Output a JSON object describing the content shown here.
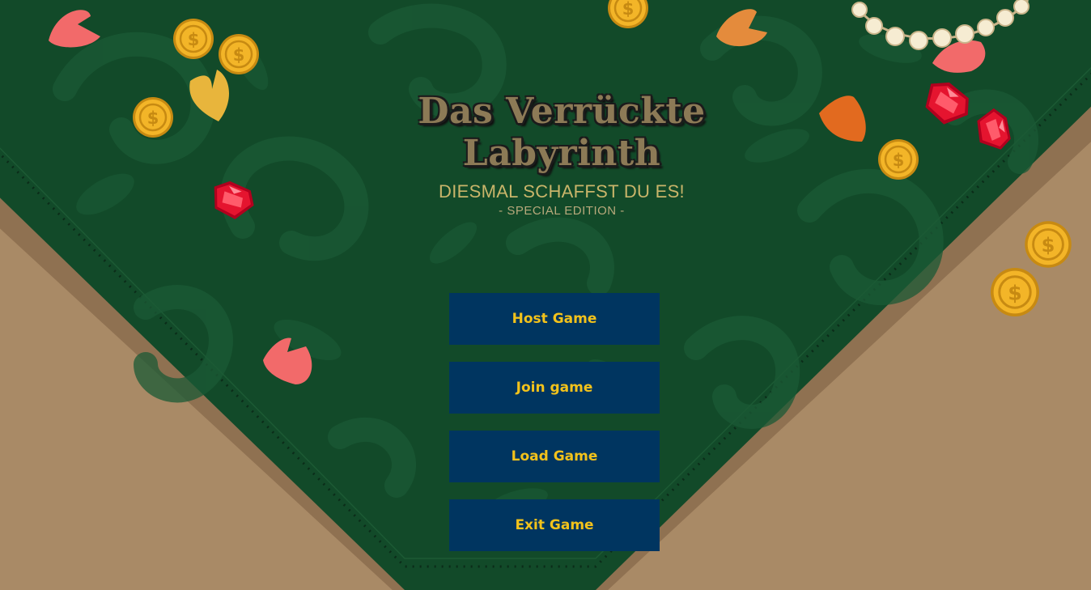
{
  "title": {
    "line1": "Das Verrückte",
    "line2": "Labyrinth"
  },
  "subtitle": "DIESMAL SCHAFFST DU ES!",
  "edition": "- SPECIAL EDITION -",
  "menu": {
    "host": "Host Game",
    "join": "Join game",
    "load": "Load Game",
    "exit": "Exit Game"
  },
  "colors": {
    "cloth_green": "#124a29",
    "table_tan": "#a98a66",
    "button_bg": "#003560",
    "button_text": "#f2c21b",
    "subtitle": "#c9b56a"
  },
  "decorations": [
    "coin-icon",
    "ruby-gem-icon",
    "petal-icon",
    "pearl-necklace-icon"
  ]
}
